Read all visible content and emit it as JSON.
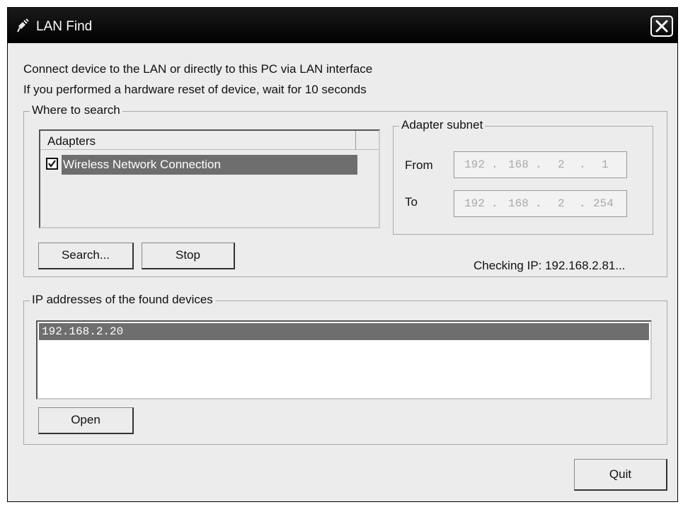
{
  "window": {
    "title": "LAN Find",
    "app_icon": "network-plug-icon",
    "close_icon": "close-icon"
  },
  "instructions": {
    "line1": "Connect device to the LAN or directly to this PC via LAN interface",
    "line2": "If you performed a hardware reset of device, wait for 10 seconds"
  },
  "where_to_search": {
    "label": "Where to search",
    "adapters": {
      "header": "Adapters",
      "items": [
        {
          "label": "Wireless Network Connection",
          "checked": true
        }
      ]
    },
    "subnet": {
      "label": "Adapter subnet",
      "from_label": "From",
      "from": [
        "192",
        "168",
        "2",
        "1"
      ],
      "to_label": "To",
      "to": [
        "192",
        "168",
        "2",
        "254"
      ]
    },
    "search_button": "Search...",
    "stop_button": "Stop",
    "status": "Checking IP: 192.168.2.81..."
  },
  "found_devices": {
    "label": "IP addresses of the found devices",
    "items": [
      "192.168.2.20"
    ],
    "open_button": "Open"
  },
  "quit_button": "Quit",
  "colors": {
    "selection": "#6e6e6e",
    "titlebar": "#000000",
    "dialog_bg": "#ececec"
  }
}
